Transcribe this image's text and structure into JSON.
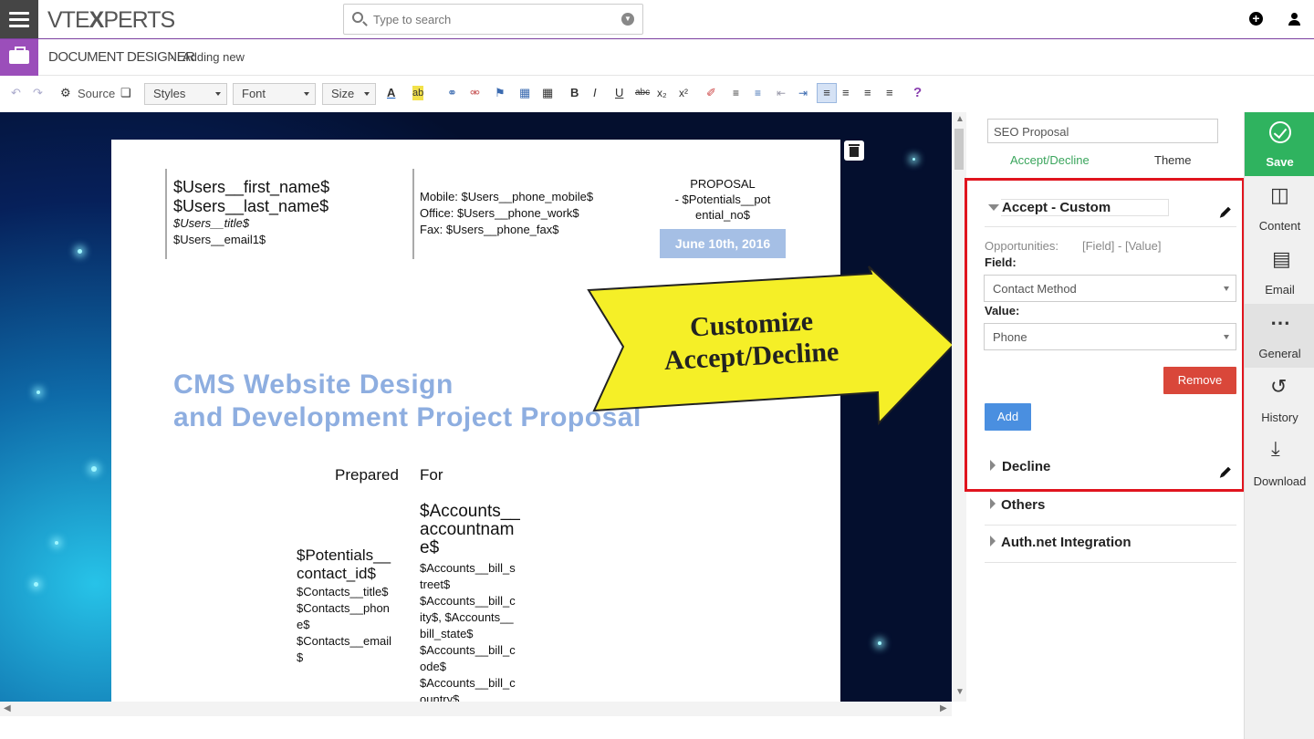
{
  "topbar": {
    "logo_a": "VTE",
    "logo_b": "X",
    "logo_c": "PERTS",
    "search_placeholder": "Type to search"
  },
  "breadcrumb": {
    "module": "DOCUMENT DESIGNER",
    "current": "Adding new"
  },
  "toolbar": {
    "source": "Source",
    "styles": "Styles",
    "font": "Font",
    "size": "Size"
  },
  "document": {
    "user_name1": "$Users__first_name$",
    "user_name2": "$Users__last_name$",
    "user_title": "$Users__title$",
    "user_email": "$Users__email1$",
    "mobile": "Mobile: $Users__phone_mobile$",
    "office": "Office: $Users__phone_work$",
    "fax": "Fax: $Users__phone_fax$",
    "proposal1": "PROPOSAL",
    "proposal2": "- $Potentials__pot",
    "proposal3": "ential_no$",
    "date": "June 10th, 2016",
    "title1": "CMS Website Design",
    "title2": "and Development Project Proposal",
    "prepared": "Prepared",
    "for": "For",
    "contact1": "$Potentials__",
    "contact2": "contact_id$",
    "contact_lines": [
      "$Contacts__title$",
      "$Contacts__phon",
      "e$",
      "$Contacts__email",
      "$"
    ],
    "acc1": "$Accounts__",
    "acc2": "accountnam",
    "acc3": "e$",
    "acc_lines": [
      "$Accounts__bill_s",
      "treet$",
      "$Accounts__bill_c",
      "ity$, $Accounts__",
      "bill_state$",
      "$Accounts__bill_c",
      "ode$",
      "$Accounts__bill_c",
      "ountry$"
    ]
  },
  "callout": {
    "line1": "Customize",
    "line2": "Accept/Decline"
  },
  "panel": {
    "template_name": "SEO Proposal",
    "tab_accept": "Accept/Decline",
    "tab_theme": "Theme",
    "accept_title": "Accept - Custom",
    "condition_module": "Opportunities:",
    "condition_hint": "[Field] - [Value]",
    "field_label": "Field:",
    "field_value": "Contact Method",
    "value_label": "Value:",
    "value_value": "Phone",
    "remove": "Remove",
    "add": "Add",
    "decline": "Decline",
    "others": "Others",
    "authnet": "Auth.net Integration"
  },
  "sidebar": {
    "save": "Save",
    "content": "Content",
    "email": "Email",
    "general": "General",
    "history": "History",
    "download": "Download"
  },
  "colors": {
    "accent_purple": "#9b4eba",
    "save_green": "#2fb35f",
    "remove_red": "#d9473a",
    "add_blue": "#4a8fe0",
    "highlight_red": "#e0141e",
    "tab_active_green": "#3aa55c"
  }
}
